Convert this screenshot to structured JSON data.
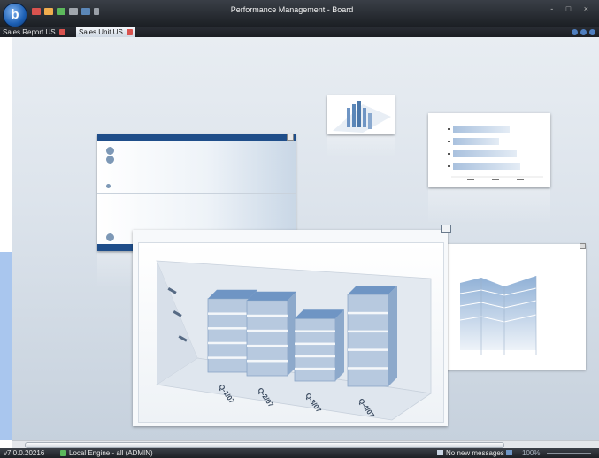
{
  "window": {
    "title": "Performance Management - Board",
    "app_logo_letter": "b",
    "controls": "- □ ×"
  },
  "tabs": [
    {
      "label": "Sales Report US",
      "active": false
    },
    {
      "label": "Sales Unit US",
      "active": true
    }
  ],
  "colors": {
    "accent": "#5b87b8",
    "bar_top": "#6f95c4",
    "bar_body": "#b7c9df"
  },
  "presentation_cards": {
    "front_chart": {
      "type": "3d-bar",
      "categories": [
        "Q-1/07",
        "Q-2/07",
        "Q-3/07",
        "Q-4/07"
      ],
      "relative_heights": [
        0.8,
        0.82,
        0.68,
        1.0
      ]
    }
  },
  "statusbar": {
    "version": "v7.0.0.20216",
    "engine": "Local Engine - all (ADMIN)",
    "messages": "No new messages",
    "zoom": "100%"
  }
}
